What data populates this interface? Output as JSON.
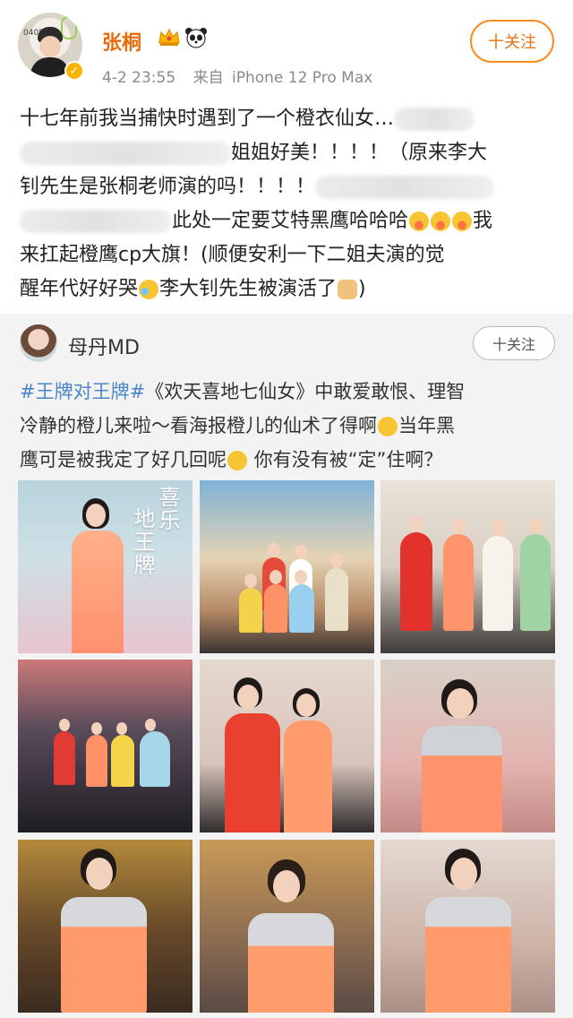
{
  "post": {
    "username": "张桐",
    "avatar_tag": "0405",
    "verified_glyph": "✓",
    "timestamp": "4-2 23:55",
    "source_prefix": "来自",
    "device": "iPhone 12 Pro Max",
    "follow_label": "十关注",
    "text": {
      "l1": "十七年前我当捕快时遇到了一个橙衣仙女…",
      "l2": "姐姐好美！！！！（原来李大",
      "l3": "钊先生是张桐老师演的吗！！！！",
      "l4a": "此处一定要艾特黑鹰哈哈哈",
      "l4b": "我",
      "l5": "来扛起橙鹰cp大旗！(顺便安利一下二姐夫演的觉",
      "l6a": "醒年代好好哭",
      "l6b": "李大钊先生被演活了",
      "l6c": ")"
    },
    "icons": [
      "crown-icon",
      "panda-icon",
      "verified-icon"
    ]
  },
  "repost": {
    "username": "母丹MD",
    "follow_label": "十关注",
    "text": {
      "hashtag": "#王牌对王牌#",
      "l1": "《欢天喜地七仙女》中敢爱敢恨、理智",
      "l2a": "冷静的橙儿来啦～看海报橙儿的仙术了得啊",
      "l2b": "当年黑",
      "l3a": "鹰可是被我定了好几回呢",
      "l3b": " 你有没有被“定”住啊？"
    },
    "poster_title_a": "喜乐",
    "poster_title_b": "地王牌",
    "images": [
      "photo-1",
      "photo-2",
      "photo-3",
      "photo-4",
      "photo-5",
      "photo-6",
      "photo-7",
      "photo-8",
      "photo-9"
    ]
  },
  "colors": {
    "brand_orange": "#e86b0c",
    "follow_border": "#ff8a1f",
    "meta_gray": "#8a8a8a",
    "hashtag_blue": "#4a86c8",
    "repost_bg": "#f3f3f3"
  }
}
